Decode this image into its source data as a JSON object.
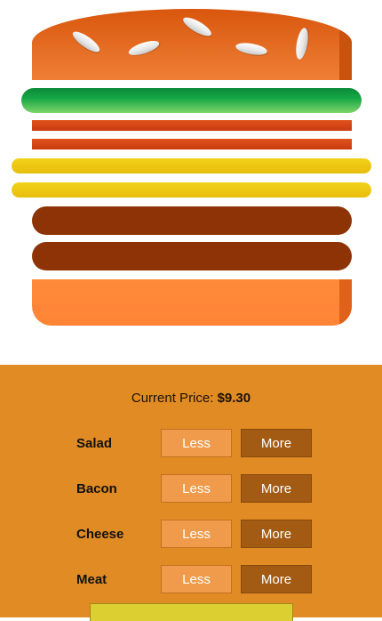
{
  "price": {
    "label": "Current Price:",
    "value": "$9.30"
  },
  "ingredients": [
    {
      "name": "Salad",
      "less": "Less",
      "more": "More"
    },
    {
      "name": "Bacon",
      "less": "Less",
      "more": "More"
    },
    {
      "name": "Cheese",
      "less": "Less",
      "more": "More"
    },
    {
      "name": "Meat",
      "less": "Less",
      "more": "More"
    }
  ],
  "colors": {
    "panel": "#e08b23",
    "less_button": "#ef9b4b",
    "more_button": "#a35a13",
    "lettuce": "#16a645",
    "bacon": "#d0451a",
    "cheese": "#efcd15",
    "meat": "#8e3305",
    "bun": "#e8732a"
  }
}
